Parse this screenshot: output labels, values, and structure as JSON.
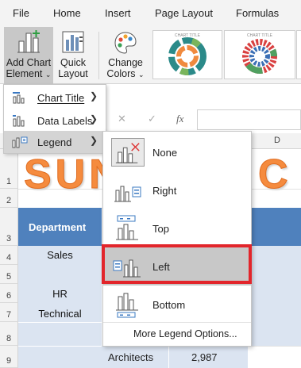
{
  "ribbon": {
    "tabs": [
      "File",
      "Home",
      "Insert",
      "Page Layout",
      "Formulas"
    ],
    "add_chart_element": [
      "Add Chart",
      "Element"
    ],
    "quick_layout": [
      "Quick",
      "Layout"
    ],
    "change_colors": [
      "Change",
      "Colors"
    ],
    "thumb_title": "CHART TITLE"
  },
  "formula_bar": {
    "cancel": "✕",
    "confirm": "✓",
    "fx": "fx"
  },
  "sheet": {
    "column_header": "D",
    "title_art": "SUN",
    "title_art_tail": "C",
    "rows": [
      "1",
      "2",
      "3",
      "4",
      "5",
      "6",
      "7",
      "8",
      "9"
    ],
    "header_department": "Department",
    "departments": [
      "Sales",
      "HR",
      "Technical"
    ],
    "bottom_row": {
      "label": "Architects",
      "value": "2,987"
    }
  },
  "menu": {
    "items": [
      {
        "label": "Chart Title",
        "accel": "C"
      },
      {
        "label": "Data Labels",
        "accel": "D"
      },
      {
        "label": "Legend",
        "accel": "L"
      }
    ]
  },
  "legend_submenu": {
    "items": [
      {
        "label": "None",
        "accel": "N"
      },
      {
        "label": "Right",
        "accel": "R"
      },
      {
        "label": "Top",
        "accel": "T"
      },
      {
        "label": "Left",
        "accel": "L"
      },
      {
        "label": "Bottom",
        "accel": "B"
      }
    ],
    "more": "More Legend Options..."
  },
  "colors": {
    "accent_blue": "#4f81bd",
    "light_blue": "#dbe4f1",
    "highlight_red": "#e2252b",
    "title_orange": "#f58b3e"
  }
}
